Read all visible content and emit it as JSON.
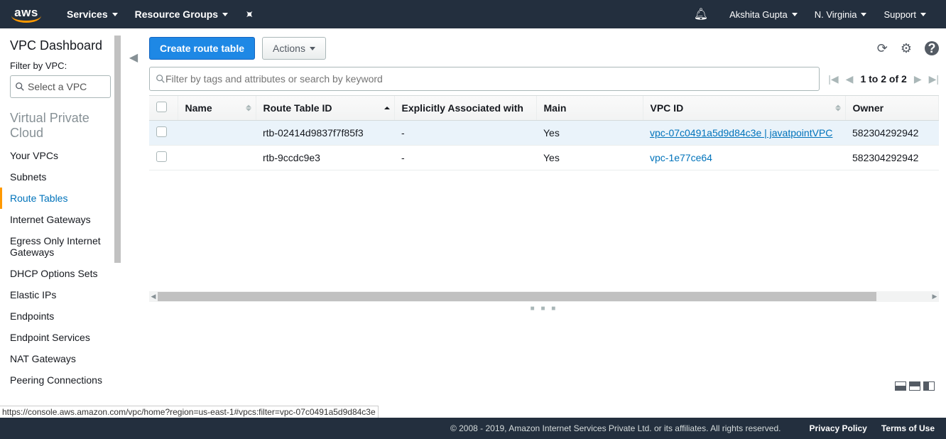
{
  "nav": {
    "logo": "aws",
    "services": "Services",
    "resource_groups": "Resource Groups",
    "user": "Akshita Gupta",
    "region": "N. Virginia",
    "support": "Support"
  },
  "sidebar": {
    "title": "VPC Dashboard",
    "filter_label": "Filter by VPC:",
    "select_placeholder": "Select a VPC",
    "section": "Virtual Private Cloud",
    "items": [
      {
        "label": "Your VPCs",
        "active": false
      },
      {
        "label": "Subnets",
        "active": false
      },
      {
        "label": "Route Tables",
        "active": true
      },
      {
        "label": "Internet Gateways",
        "active": false
      },
      {
        "label": "Egress Only Internet Gateways",
        "active": false
      },
      {
        "label": "DHCP Options Sets",
        "active": false
      },
      {
        "label": "Elastic IPs",
        "active": false
      },
      {
        "label": "Endpoints",
        "active": false
      },
      {
        "label": "Endpoint Services",
        "active": false
      },
      {
        "label": "NAT Gateways",
        "active": false
      },
      {
        "label": "Peering Connections",
        "active": false
      }
    ]
  },
  "toolbar": {
    "create": "Create route table",
    "actions": "Actions"
  },
  "search": {
    "placeholder": "Filter by tags and attributes or search by keyword"
  },
  "pager": {
    "range": "1 to 2 of 2"
  },
  "table": {
    "headers": {
      "name": "Name",
      "rtid": "Route Table ID",
      "assoc": "Explicitly Associated with",
      "main": "Main",
      "vpcid": "VPC ID",
      "owner": "Owner"
    },
    "rows": [
      {
        "name": "",
        "rtid": "rtb-02414d9837f7f85f3",
        "assoc": "-",
        "main": "Yes",
        "vpcid": "vpc-07c0491a5d9d84c3e | javatpointVPC",
        "owner": "582304292942",
        "selected": true,
        "vpc_underline": true
      },
      {
        "name": "",
        "rtid": "rtb-9ccdc9e3",
        "assoc": "-",
        "main": "Yes",
        "vpcid": "vpc-1e77ce64",
        "owner": "582304292942",
        "selected": false,
        "vpc_underline": false
      }
    ]
  },
  "footer": {
    "copyright": "© 2008 - 2019, Amazon Internet Services Private Ltd. or its affiliates. All rights reserved.",
    "privacy": "Privacy Policy",
    "terms": "Terms of Use"
  },
  "status_url": "https://console.aws.amazon.com/vpc/home?region=us-east-1#vpcs:filter=vpc-07c0491a5d9d84c3e"
}
